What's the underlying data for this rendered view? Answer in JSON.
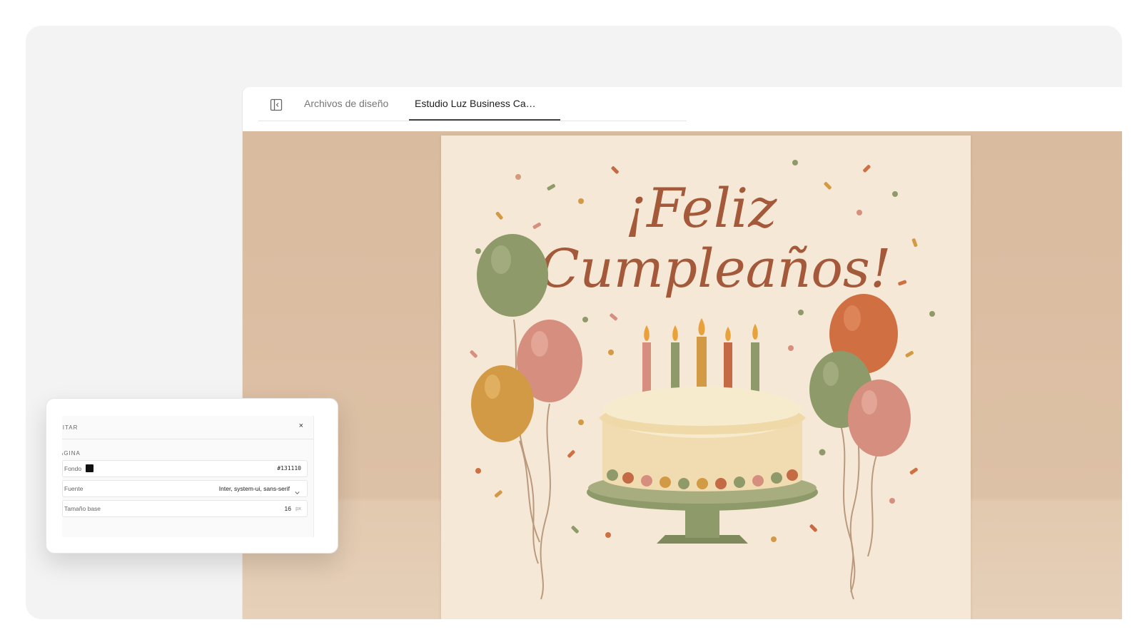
{
  "tabs": [
    {
      "label": "Archivos de diseño"
    },
    {
      "label": "Estudio Luz Business Ca…"
    }
  ],
  "card": {
    "greeting_line1": "¡Feliz",
    "greeting_line2": "Cumpleaños!"
  },
  "editor": {
    "title": "DITAR",
    "close": "×",
    "section": "ÁGINA",
    "fields": [
      {
        "label": "Fondo",
        "value": "#131110",
        "color": "#131110"
      },
      {
        "label": "Fuente",
        "value": "Inter, system-ui, sans-serif"
      },
      {
        "label": "Tamaño base",
        "value": "16",
        "unit": "px"
      }
    ]
  },
  "icons": [
    "sidebar-toggle-icon",
    "close-icon",
    "chevron-down-icon"
  ],
  "colors": {
    "canvas": "#d9bb9f",
    "card": "#f6e8d6",
    "lettering": "#a45a3a",
    "olive": "#8f9a6a",
    "pink": "#d68f7e",
    "orange": "#d07042",
    "mustard": "#d39a45"
  }
}
